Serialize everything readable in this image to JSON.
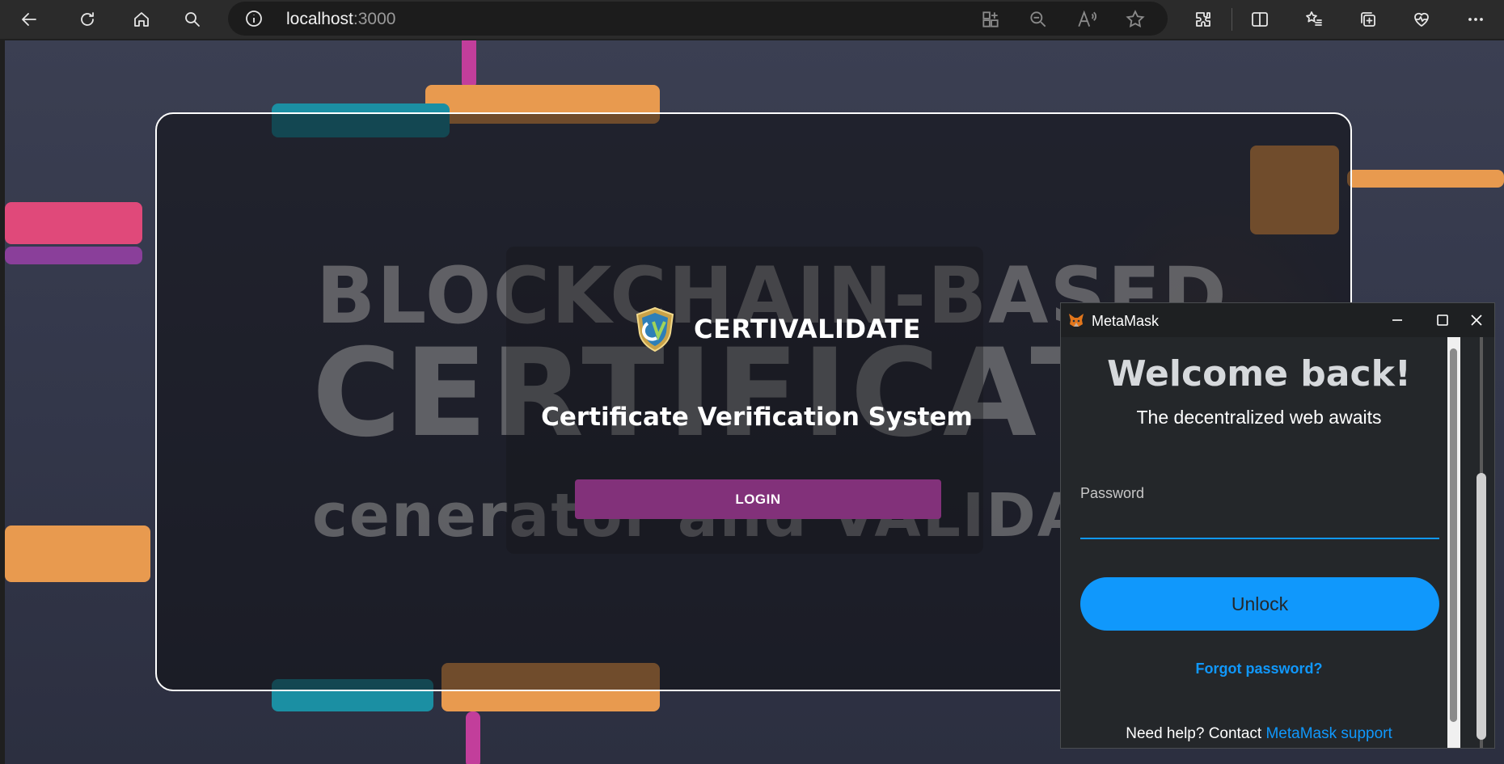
{
  "browser": {
    "url_host": "localhost",
    "url_port": ":3000",
    "icons": [
      "back-icon",
      "refresh-icon",
      "home-icon",
      "search-icon",
      "info-icon",
      "app-install-icon",
      "zoom-out-icon",
      "read-aloud-icon",
      "favorite-star-icon",
      "extensions-icon",
      "split-screen-icon",
      "favorites-icon",
      "collections-icon",
      "performance-icon",
      "more-icon"
    ]
  },
  "page": {
    "hero_line1": "BLOCKCHAIN-BASED",
    "hero_line2": "CERTIFICAT",
    "hero_line3": "cenerator and VALIDAT",
    "brand": "CERTIVALIDATE",
    "subtitle": "Certificate Verification System",
    "login_label": "LOGIN",
    "colors": {
      "login_button": "#82317a",
      "card_border": "#ffffff"
    }
  },
  "metamask": {
    "window_title": "MetaMask",
    "welcome": "Welcome back!",
    "tagline": "The decentralized web awaits",
    "password_label": "Password",
    "password_value": "",
    "unlock_label": "Unlock",
    "forgot_label": "Forgot password?",
    "help_prefix": "Need help? Contact ",
    "help_link": "MetaMask support",
    "accent": "#1098fc"
  }
}
